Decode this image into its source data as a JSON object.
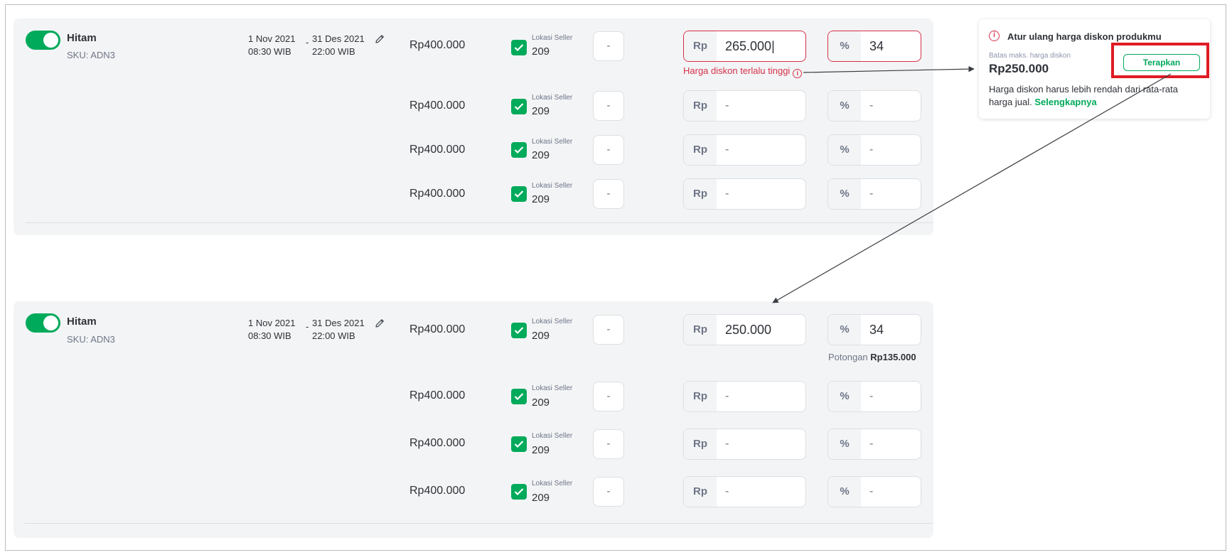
{
  "colors": {
    "accent_green": "#00aa5b",
    "error_red": "#d6304a",
    "highlight_red": "#e01b24",
    "card_bg": "#f3f4f5"
  },
  "icons": [
    "toggle-switch",
    "pencil-icon",
    "checkbox-checked-icon",
    "info-icon",
    "arrow"
  ],
  "top_section": {
    "variant": {
      "name": "Hitam",
      "sku": "SKU: ADN3",
      "active": true
    },
    "period": {
      "start_date": "1 Nov 2021",
      "start_time": "08:30 WIB",
      "separator": "-",
      "end_date": "31 Des 2021",
      "end_time": "22:00 WIB"
    },
    "rows": [
      {
        "price": "Rp400.000",
        "location_label": "Lokasi Seller",
        "location_value": "209",
        "stock": "-",
        "rp_prefix": "Rp",
        "discount_price": "265.000|",
        "pct_prefix": "%",
        "discount_pct": "34"
      },
      {
        "price": "Rp400.000",
        "location_label": "Lokasi Seller",
        "location_value": "209",
        "stock": "-",
        "rp_prefix": "Rp",
        "discount_price": "-",
        "pct_prefix": "%",
        "discount_pct": "-"
      },
      {
        "price": "Rp400.000",
        "location_label": "Lokasi Seller",
        "location_value": "209",
        "stock": "-",
        "rp_prefix": "Rp",
        "discount_price": "-",
        "pct_prefix": "%",
        "discount_pct": "-"
      },
      {
        "price": "Rp400.000",
        "location_label": "Lokasi Seller",
        "location_value": "209",
        "stock": "-",
        "rp_prefix": "Rp",
        "discount_price": "-",
        "pct_prefix": "%",
        "discount_pct": "-"
      }
    ],
    "error_message": "Harga diskon terlalu tinggi",
    "info_glyph": "i"
  },
  "bottom_section": {
    "variant": {
      "name": "Hitam",
      "sku": "SKU: ADN3",
      "active": true
    },
    "period": {
      "start_date": "1 Nov 2021",
      "start_time": "08:30 WIB",
      "separator": "-",
      "end_date": "31 Des 2021",
      "end_time": "22:00 WIB"
    },
    "rows": [
      {
        "price": "Rp400.000",
        "location_label": "Lokasi Seller",
        "location_value": "209",
        "stock": "-",
        "rp_prefix": "Rp",
        "discount_price": "250.000",
        "pct_prefix": "%",
        "discount_pct": "34"
      },
      {
        "price": "Rp400.000",
        "location_label": "Lokasi Seller",
        "location_value": "209",
        "stock": "-",
        "rp_prefix": "Rp",
        "discount_price": "-",
        "pct_prefix": "%",
        "discount_pct": "-"
      },
      {
        "price": "Rp400.000",
        "location_label": "Lokasi Seller",
        "location_value": "209",
        "stock": "-",
        "rp_prefix": "Rp",
        "discount_price": "-",
        "pct_prefix": "%",
        "discount_pct": "-"
      },
      {
        "price": "Rp400.000",
        "location_label": "Lokasi Seller",
        "location_value": "209",
        "stock": "-",
        "rp_prefix": "Rp",
        "discount_price": "-",
        "pct_prefix": "%",
        "discount_pct": "-"
      }
    ],
    "potongan_label": "Potongan",
    "potongan_value": "Rp135.000"
  },
  "popup": {
    "info_glyph": "i",
    "title": "Atur ulang harga diskon produkmu",
    "max_label": "Batas maks. harga diskon",
    "max_value": "Rp250.000",
    "apply_label": "Terapkan",
    "description": "Harga diskon harus lebih rendah dari rata-rata harga jual.",
    "link_label": "Selengkapnya"
  }
}
